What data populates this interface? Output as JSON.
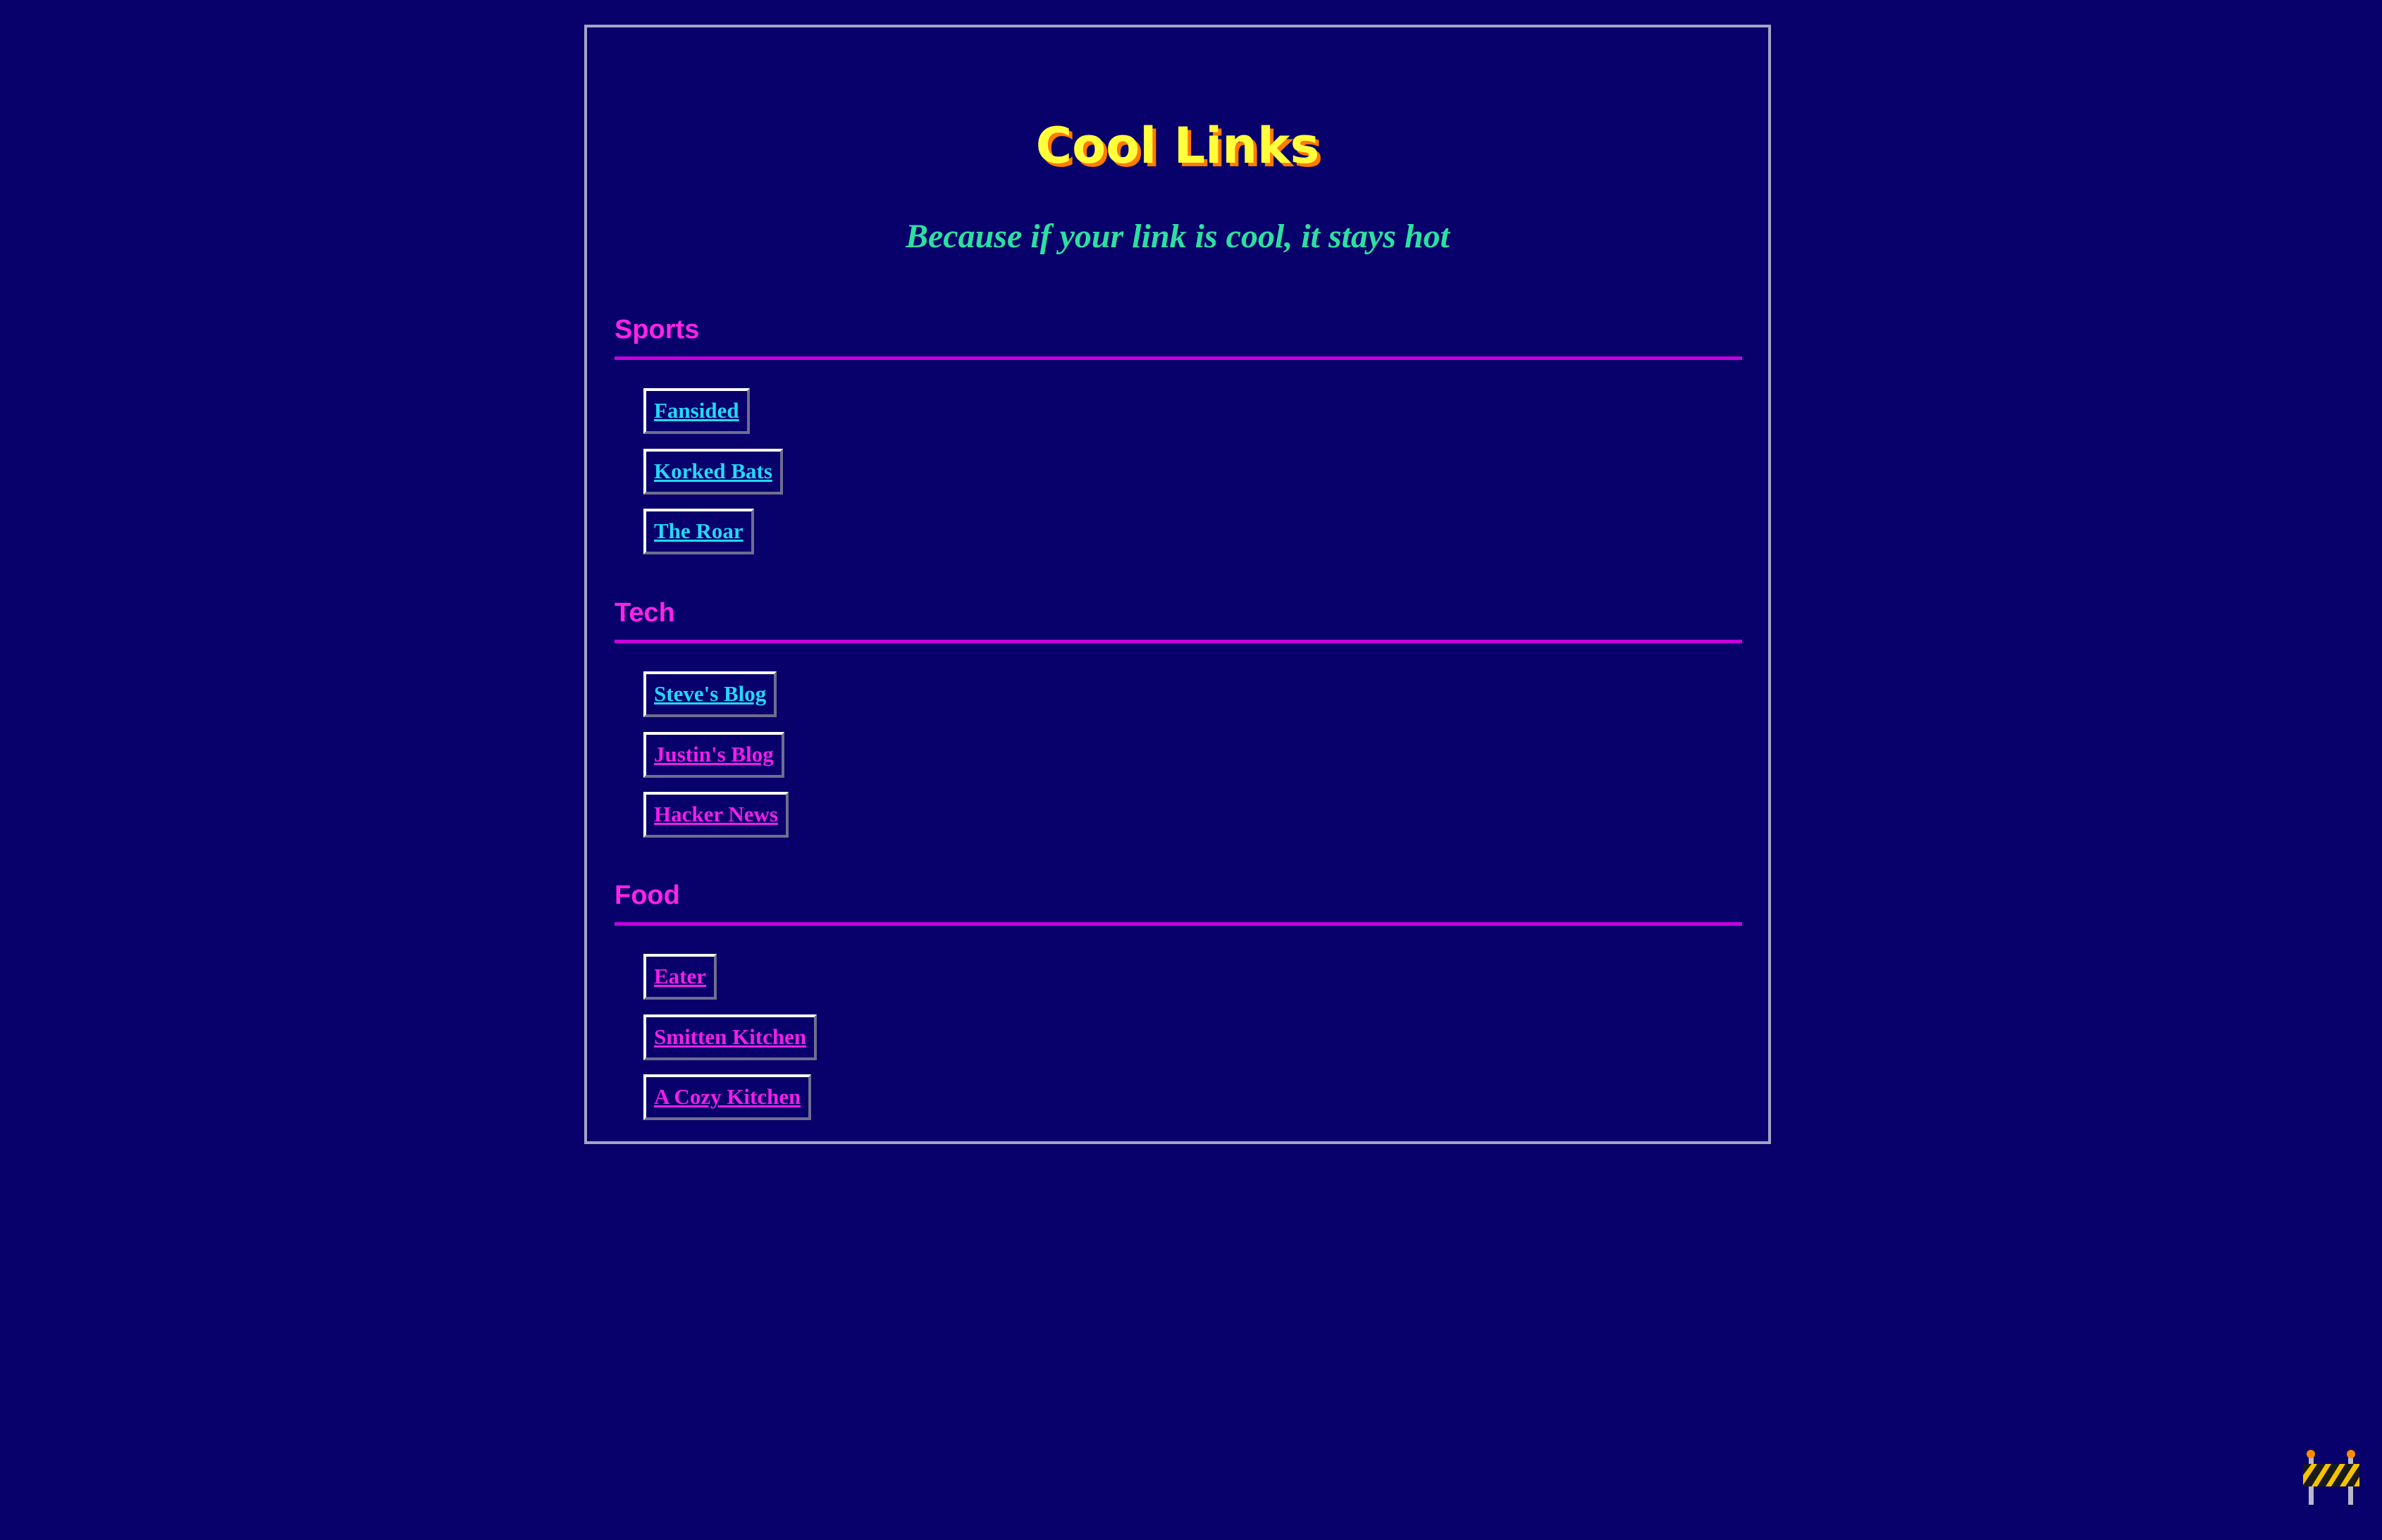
{
  "page": {
    "title": "Cool Links",
    "subtitle": "Because if your link is cool, it stays hot"
  },
  "sections": [
    {
      "heading": "Sports",
      "links": [
        {
          "label": "Fansided",
          "state": "unvisited"
        },
        {
          "label": "Korked Bats",
          "state": "unvisited"
        },
        {
          "label": "The Roar",
          "state": "unvisited"
        }
      ]
    },
    {
      "heading": "Tech",
      "links": [
        {
          "label": "Steve's Blog",
          "state": "unvisited"
        },
        {
          "label": "Justin's Blog",
          "state": "visited"
        },
        {
          "label": "Hacker News",
          "state": "visited"
        }
      ]
    },
    {
      "heading": "Food",
      "links": [
        {
          "label": "Eater",
          "state": "visited"
        },
        {
          "label": "Smitten Kitchen",
          "state": "visited"
        },
        {
          "label": "A Cozy Kitchen",
          "state": "visited"
        }
      ]
    }
  ],
  "colors": {
    "background": "#08006b",
    "title": "#ffff3c",
    "title_shadow": "#ff7a00",
    "subtitle": "#2ce0a0",
    "heading": "#ff22e8",
    "heading_rule": "#c800e0",
    "link_unvisited": "#22d8ff",
    "link_visited": "#f01ee8"
  },
  "icons": {
    "corner": "construction-barrier-icon"
  }
}
